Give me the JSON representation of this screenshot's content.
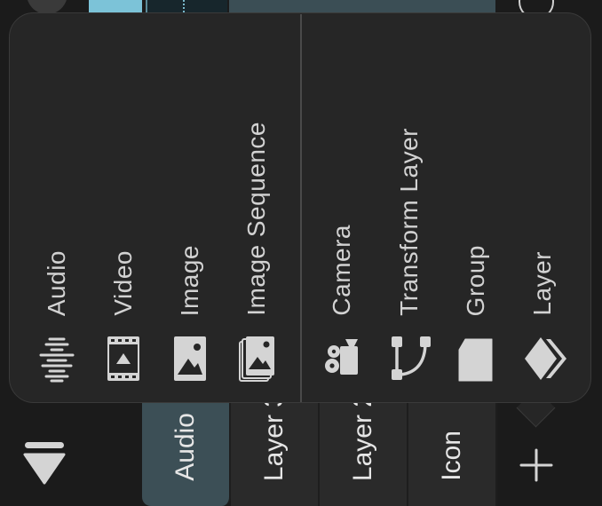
{
  "menu": {
    "items": [
      {
        "label": "Audio",
        "icon": "audio-waveform-icon"
      },
      {
        "label": "Video",
        "icon": "video-film-icon"
      },
      {
        "label": "Image",
        "icon": "image-icon"
      },
      {
        "label": "Image Sequence",
        "icon": "image-sequence-icon"
      },
      {
        "label": "Camera",
        "icon": "camera-icon"
      },
      {
        "label": "Transform Layer",
        "icon": "transform-layer-icon"
      },
      {
        "label": "Group",
        "icon": "group-icon"
      },
      {
        "label": "Layer",
        "icon": "layer-icon"
      }
    ]
  },
  "tracks": [
    {
      "label": "Audio",
      "active": true
    },
    {
      "label": "Layer 3"
    },
    {
      "label": "Layer 2"
    },
    {
      "label": "Icon"
    }
  ],
  "colors": {
    "background": "#1b1b1b",
    "popup": "#262626",
    "active_track": "#3c4f56",
    "clip_cyan": "#7cc3d8"
  }
}
